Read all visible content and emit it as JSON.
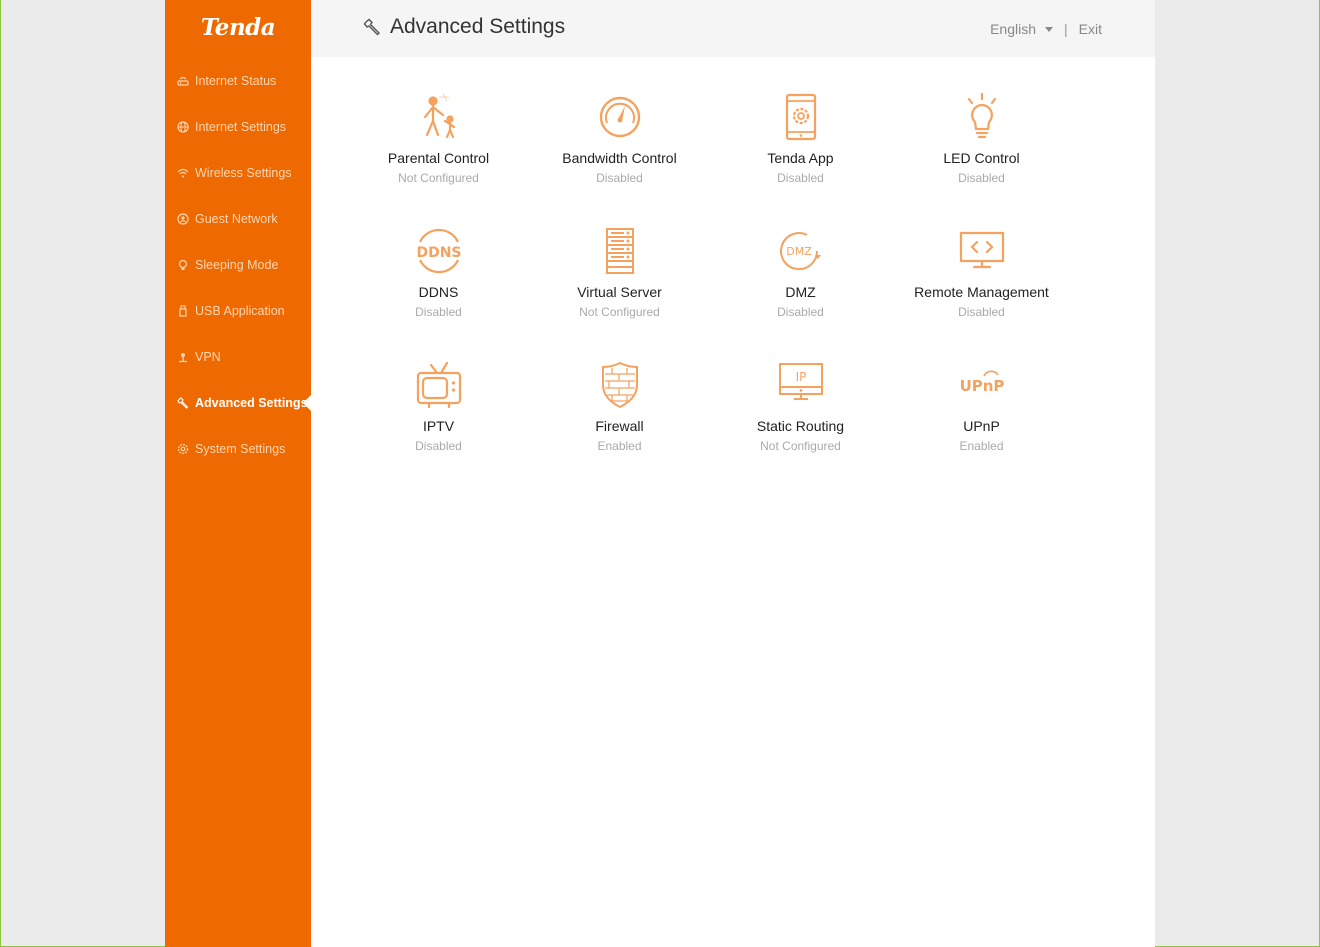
{
  "brand": {
    "logo_text": "Tenda",
    "accent": "#ee6a00",
    "icon_color": "#f5a25f"
  },
  "sidebar": {
    "items": [
      {
        "label": "Internet Status",
        "icon": "router-icon",
        "active": false
      },
      {
        "label": "Internet Settings",
        "icon": "globe-icon",
        "active": false
      },
      {
        "label": "Wireless Settings",
        "icon": "wifi-icon",
        "active": false
      },
      {
        "label": "Guest Network",
        "icon": "guest-network-icon",
        "active": false
      },
      {
        "label": "Sleeping Mode",
        "icon": "bulb-icon",
        "active": false
      },
      {
        "label": "USB Application",
        "icon": "usb-icon",
        "active": false
      },
      {
        "label": "VPN",
        "icon": "vpn-icon",
        "active": false
      },
      {
        "label": "Advanced Settings",
        "icon": "wrench-icon",
        "active": true
      },
      {
        "label": "System Settings",
        "icon": "gear-icon",
        "active": false
      }
    ]
  },
  "header": {
    "title": "Advanced Settings",
    "language": "English",
    "separator": "|",
    "exit_label": "Exit"
  },
  "features": [
    {
      "name": "Parental Control",
      "status": "Not Configured",
      "icon": "parental-control-icon"
    },
    {
      "name": "Bandwidth Control",
      "status": "Disabled",
      "icon": "bandwidth-gauge-icon"
    },
    {
      "name": "Tenda App",
      "status": "Disabled",
      "icon": "phone-gear-icon"
    },
    {
      "name": "LED Control",
      "status": "Disabled",
      "icon": "led-bulb-icon"
    },
    {
      "name": "DDNS",
      "status": "Disabled",
      "icon": "ddns-icon",
      "icon_text": "DDNS"
    },
    {
      "name": "Virtual Server",
      "status": "Not Configured",
      "icon": "server-rack-icon"
    },
    {
      "name": "DMZ",
      "status": "Disabled",
      "icon": "dmz-icon",
      "icon_text": "DMZ"
    },
    {
      "name": "Remote Management",
      "status": "Disabled",
      "icon": "monitor-code-icon"
    },
    {
      "name": "IPTV",
      "status": "Disabled",
      "icon": "tv-icon"
    },
    {
      "name": "Firewall",
      "status": "Enabled",
      "icon": "shield-icon"
    },
    {
      "name": "Static Routing",
      "status": "Not Configured",
      "icon": "ip-monitor-icon",
      "icon_text": "IP"
    },
    {
      "name": "UPnP",
      "status": "Enabled",
      "icon": "upnp-icon",
      "icon_text": "UPnP"
    }
  ]
}
